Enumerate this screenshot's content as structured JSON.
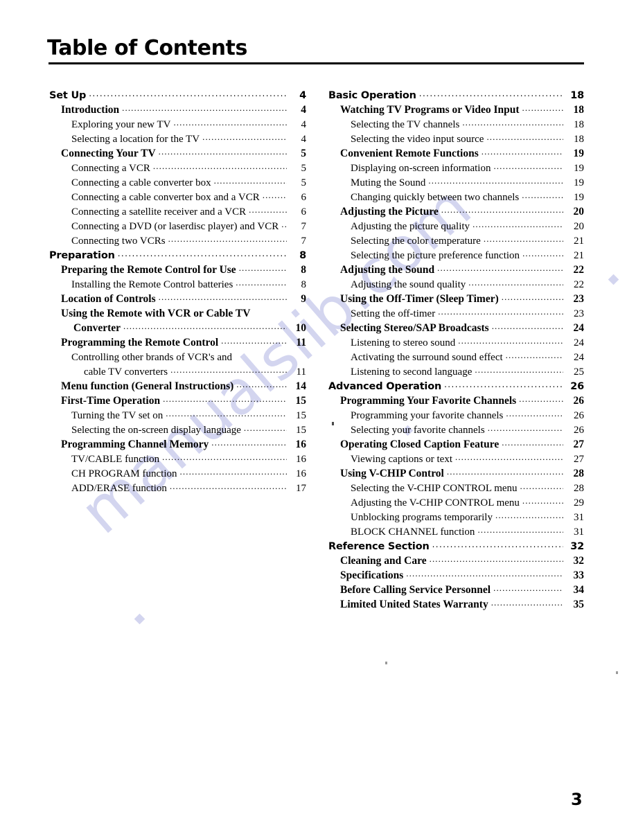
{
  "page": {
    "title": "Table of Contents",
    "folio": "3",
    "watermark": "manualslib.com",
    "watermark_color": "#d3d5ef"
  },
  "left_column": [
    {
      "level": 1,
      "label": "Set Up",
      "page": "4"
    },
    {
      "level": 2,
      "label": "Introduction",
      "page": "4"
    },
    {
      "level": 3,
      "label": "Exploring your new TV",
      "page": "4"
    },
    {
      "level": 3,
      "label": "Selecting a location for the TV",
      "page": "4"
    },
    {
      "level": 2,
      "label": "Connecting Your TV",
      "page": "5"
    },
    {
      "level": 3,
      "label": "Connecting a VCR",
      "page": "5"
    },
    {
      "level": 3,
      "label": "Connecting a cable converter box",
      "page": "5"
    },
    {
      "level": 3,
      "label": "Connecting a cable converter box and a VCR",
      "page": "6"
    },
    {
      "level": 3,
      "label": "Connecting a satellite receiver and a VCR",
      "page": "6"
    },
    {
      "level": 3,
      "label": "Connecting a DVD (or laserdisc player) and VCR",
      "page": "7"
    },
    {
      "level": 3,
      "label": "Connecting two VCRs",
      "page": "7"
    },
    {
      "level": 1,
      "label": "Preparation",
      "page": "8"
    },
    {
      "level": 2,
      "label": "Preparing the Remote Control for Use",
      "page": "8"
    },
    {
      "level": 3,
      "label": "Installing the Remote Control batteries",
      "page": "8"
    },
    {
      "level": 2,
      "label": "Location of Controls",
      "page": "9"
    },
    {
      "level": 2,
      "label": "Using the Remote with VCR or Cable TV",
      "page": "",
      "wrap": "first"
    },
    {
      "level": 2,
      "label": "Converter",
      "page": "10",
      "wrap": "second"
    },
    {
      "level": 2,
      "label": "Programming the Remote Control",
      "page": "11"
    },
    {
      "level": 3,
      "label": "Controlling other brands of VCR's and",
      "page": "",
      "wrap": "first"
    },
    {
      "level": 3,
      "label": "cable TV converters",
      "page": "11",
      "wrap": "second"
    },
    {
      "level": 2,
      "label": "Menu function (General Instructions)",
      "page": "14"
    },
    {
      "level": 2,
      "label": "First-Time Operation",
      "page": "15"
    },
    {
      "level": 3,
      "label": "Turning the TV set on",
      "page": "15"
    },
    {
      "level": 3,
      "label": "Selecting the on-screen display language",
      "page": "15"
    },
    {
      "level": 2,
      "label": "Programming Channel Memory",
      "page": "16"
    },
    {
      "level": 3,
      "label": "TV/CABLE function",
      "page": "16"
    },
    {
      "level": 3,
      "label": "CH PROGRAM function",
      "page": "16"
    },
    {
      "level": 3,
      "label": "ADD/ERASE function",
      "page": "17"
    }
  ],
  "right_column": [
    {
      "level": 1,
      "label": "Basic Operation",
      "page": "18"
    },
    {
      "level": 2,
      "label": "Watching TV Programs or Video Input",
      "page": "18"
    },
    {
      "level": 3,
      "label": "Selecting the TV channels",
      "page": "18"
    },
    {
      "level": 3,
      "label": "Selecting the video input source",
      "page": "18"
    },
    {
      "level": 2,
      "label": "Convenient Remote Functions",
      "page": "19"
    },
    {
      "level": 3,
      "label": "Displaying on-screen information",
      "page": "19"
    },
    {
      "level": 3,
      "label": "Muting the Sound",
      "page": "19"
    },
    {
      "level": 3,
      "label": "Changing quickly between two channels",
      "page": "19"
    },
    {
      "level": 2,
      "label": "Adjusting the Picture",
      "page": "20"
    },
    {
      "level": 3,
      "label": "Adjusting the picture quality",
      "page": "20"
    },
    {
      "level": 3,
      "label": "Selecting the color temperature",
      "page": "21"
    },
    {
      "level": 3,
      "label": "Selecting the picture preference function",
      "page": "21"
    },
    {
      "level": 2,
      "label": "Adjusting the Sound",
      "page": "22"
    },
    {
      "level": 3,
      "label": "Adjusting the sound quality",
      "page": "22"
    },
    {
      "level": 2,
      "label": "Using the Off-Timer (Sleep Timer)",
      "page": "23"
    },
    {
      "level": 3,
      "label": "Setting the off-timer",
      "page": "23"
    },
    {
      "level": 2,
      "label": "Selecting Stereo/SAP Broadcasts",
      "page": "24"
    },
    {
      "level": 3,
      "label": "Listening to stereo sound",
      "page": "24"
    },
    {
      "level": 3,
      "label": "Activating the surround sound effect",
      "page": "24"
    },
    {
      "level": 3,
      "label": "Listening to second language",
      "page": "25"
    },
    {
      "level": 1,
      "label": "Advanced Operation",
      "page": "26"
    },
    {
      "level": 2,
      "label": "Programming Your Favorite Channels",
      "page": "26"
    },
    {
      "level": 3,
      "label": "Programming your favorite channels",
      "page": "26"
    },
    {
      "level": 3,
      "label": "Selecting your favorite channels",
      "page": "26"
    },
    {
      "level": 2,
      "label": "Operating Closed Caption Feature",
      "page": "27"
    },
    {
      "level": 3,
      "label": "Viewing captions or text",
      "page": "27"
    },
    {
      "level": 2,
      "label": "Using V-CHIP Control",
      "page": "28"
    },
    {
      "level": 3,
      "label": "Selecting the V-CHIP CONTROL menu",
      "page": "28"
    },
    {
      "level": 3,
      "label": "Adjusting the V-CHIP CONTROL menu",
      "page": "29"
    },
    {
      "level": 3,
      "label": "Unblocking programs temporarily",
      "page": "31"
    },
    {
      "level": 3,
      "label": "BLOCK CHANNEL function",
      "page": "31"
    },
    {
      "level": 1,
      "label": "Reference Section",
      "page": "32"
    },
    {
      "level": 2,
      "label": "Cleaning and Care",
      "page": "32"
    },
    {
      "level": 2,
      "label": "Specifications",
      "page": "33"
    },
    {
      "level": 2,
      "label": "Before Calling Service Personnel",
      "page": "34"
    },
    {
      "level": 2,
      "label": "Limited United States Warranty",
      "page": "35"
    }
  ]
}
